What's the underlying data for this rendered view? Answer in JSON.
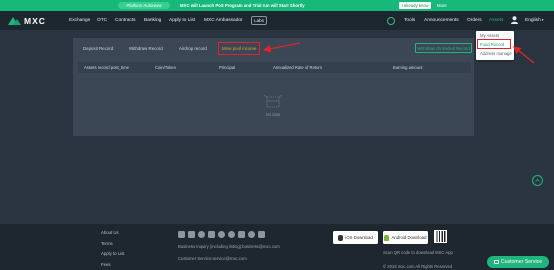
{
  "banner": {
    "pill": "Platform Autowww",
    "message": "MXC will Launch PoS Program and Trial run will Start Shortly",
    "know_button": "I already know",
    "more_link": "More"
  },
  "logo": {
    "text": "MXC"
  },
  "nav": {
    "items": [
      "Exchange",
      "OTC",
      "Contracts",
      "Banking",
      "Apply to List",
      "MXC Ambassador"
    ],
    "labs": "Labs",
    "right_items": [
      "Tools",
      "Announcements",
      "Orders",
      "Assets"
    ],
    "language": "English"
  },
  "assets_dropdown": {
    "items": [
      "My Assets",
      "Fund Record",
      "Address manage"
    ]
  },
  "record": {
    "tabs": [
      "Deposit Record",
      "Withdraw Record",
      "Airdrop record",
      "Mine pool income"
    ],
    "withdraw_button": "Withdraw chronicled Record",
    "columns": [
      "Assets record post_time",
      "Coin/Token",
      "Principal",
      "Annualized Rate of Return",
      "Earning amount"
    ],
    "empty_text": "No data"
  },
  "footer": {
    "links": [
      "About Us",
      "Terms",
      "Apply to List",
      "Fees"
    ],
    "business_inquiry": "Business Inquiry (including listing):business@mxc.com",
    "customer_service": "Customer Service:service@mxc.com",
    "ios_download": "iOS Download",
    "android_download": "Android Download",
    "scan_text": "Scan QR code to download MXC App",
    "copyright": "© 2018 mxc.com All Rights Reserved"
  },
  "customer_service_button": "Customer Service",
  "colors": {
    "accent": "#1fb57d",
    "highlight": "#e0242a",
    "active_tab": "#e8a23a"
  }
}
